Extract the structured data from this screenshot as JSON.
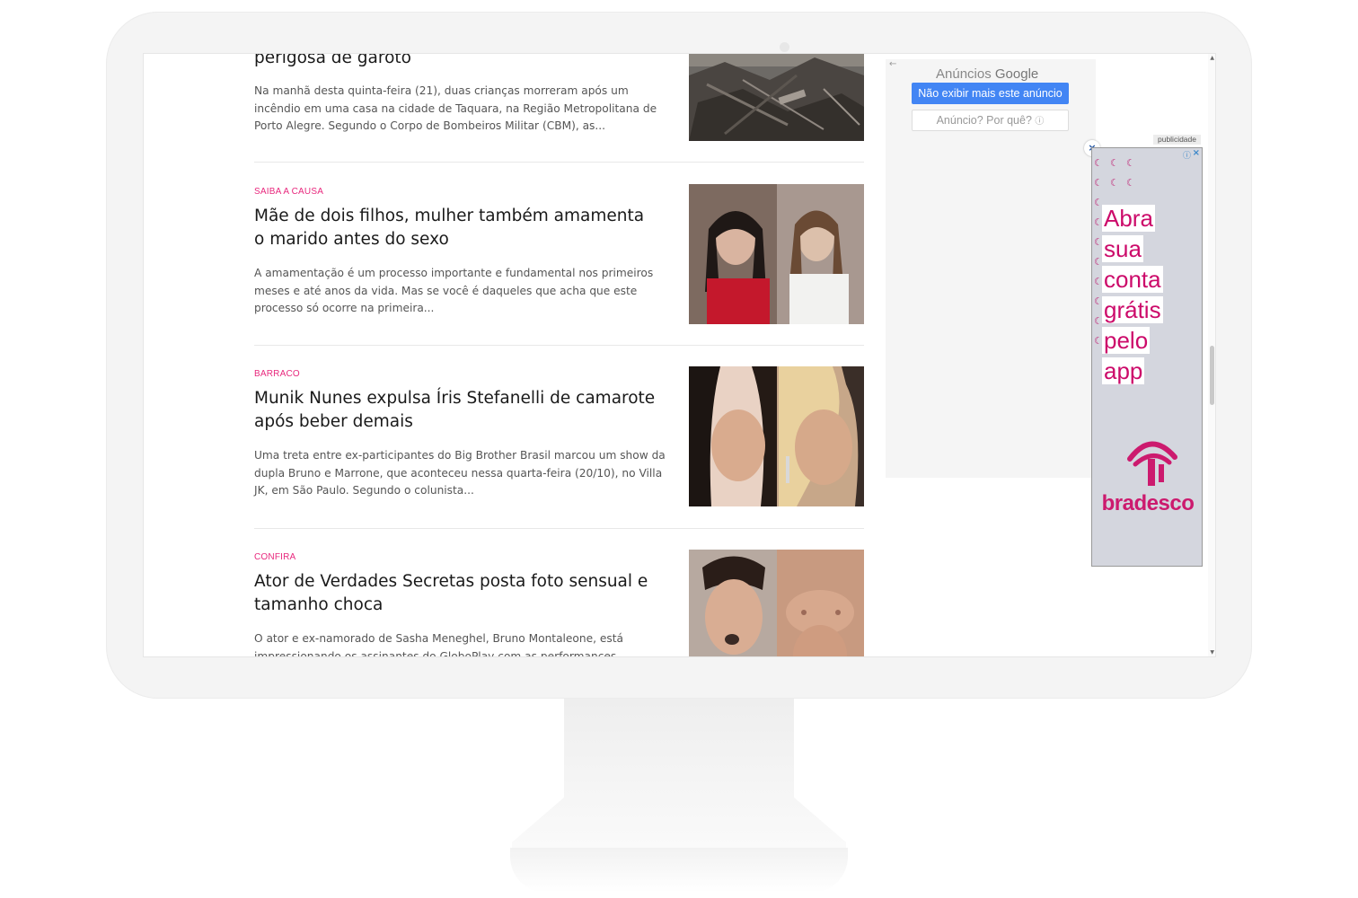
{
  "articles": [
    {
      "kicker": "",
      "headline": "perigosa de garoto",
      "excerpt": "Na manhã desta quinta-feira (21), duas crianças morreram após um incêndio em uma casa na cidade de Taquara, na Região Metropolitana de Porto Alegre. Segundo o Corpo de Bombeiros Militar (CBM), as..."
    },
    {
      "kicker": "SAIBA A CAUSA",
      "headline": "Mãe de dois filhos, mulher também amamenta o marido antes do sexo",
      "excerpt": "A amamentação é um processo importante e fundamental nos primeiros meses e até anos da vida. Mas se você é daqueles que acha que este processo só ocorre na primeira..."
    },
    {
      "kicker": "BARRACO",
      "headline": "Munik Nunes expulsa Íris Stefanelli de camarote após beber demais",
      "excerpt": "Uma treta entre ex-participantes do Big Brother Brasil marcou um show da dupla Bruno e Marrone, que aconteceu nessa quarta-feira (20/10), no Villa JK, em São Paulo. Segundo o colunista..."
    },
    {
      "kicker": "CONFIRA",
      "headline": "Ator de Verdades Secretas posta foto sensual e tamanho choca",
      "excerpt": "O ator e ex-namorado de Sasha Meneghel, Bruno Montaleone, está impressionando os assinantes do GloboPlay com as performances sensuais..."
    }
  ],
  "ad_panel": {
    "back_icon": "back-arrow-icon",
    "label_prefix": "Anúncios",
    "label_brand": "Google",
    "stop_button": "Não exibir mais este anúncio",
    "why_button": "Anúncio? Por quê?"
  },
  "publicidade_label": "publicidade",
  "bradesco_ad": {
    "words": [
      "Abra",
      "sua",
      "conta",
      "grátis",
      "pelo",
      "app"
    ],
    "brand": "bradesco",
    "brand_color": "#cc1a6e",
    "background": "#d4d6de"
  },
  "colors": {
    "kicker": "#e8287d",
    "google_blue": "#4285f4"
  }
}
